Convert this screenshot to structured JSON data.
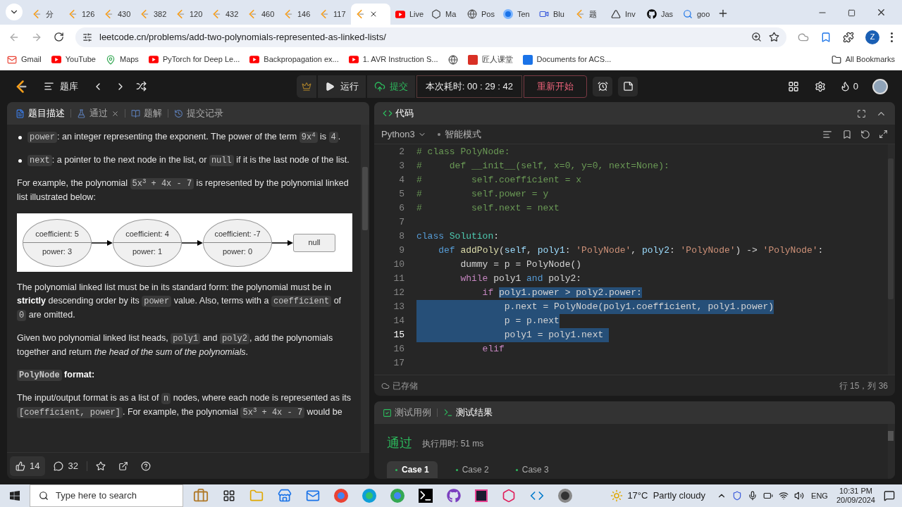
{
  "browser": {
    "tabs": [
      {
        "title": "分",
        "kind": "leetcode",
        "selected": false
      },
      {
        "title": "126",
        "kind": "leetcode",
        "selected": false
      },
      {
        "title": "430",
        "kind": "leetcode",
        "selected": false
      },
      {
        "title": "382",
        "kind": "leetcode",
        "selected": false
      },
      {
        "title": "120",
        "kind": "leetcode",
        "selected": false
      },
      {
        "title": "432",
        "kind": "leetcode",
        "selected": false
      },
      {
        "title": "460",
        "kind": "leetcode",
        "selected": false
      },
      {
        "title": "146",
        "kind": "leetcode",
        "selected": false
      },
      {
        "title": "117",
        "kind": "leetcode",
        "selected": false
      },
      {
        "kind": "leetcode",
        "selected": true
      },
      {
        "title": "Live",
        "kind": "youtube",
        "selected": false
      },
      {
        "title": "Ma",
        "kind": "openai",
        "selected": false
      },
      {
        "title": "Pos",
        "kind": "globe",
        "selected": false
      },
      {
        "title": "Ten",
        "kind": "circle",
        "selected": false
      },
      {
        "title": "Blu",
        "kind": "video",
        "selected": false
      },
      {
        "title": "题",
        "kind": "leetcode",
        "selected": false
      },
      {
        "title": "Inv",
        "kind": "triangle",
        "selected": false
      },
      {
        "title": "Jas",
        "kind": "github",
        "selected": false
      },
      {
        "title": "goo",
        "kind": "search",
        "selected": false
      }
    ],
    "url": "leetcode.cn/problems/add-two-polynomials-represented-as-linked-lists/",
    "profile": "Z",
    "bookmarks": [
      {
        "label": "Gmail",
        "kind": "gmail"
      },
      {
        "label": "YouTube",
        "kind": "youtube"
      },
      {
        "label": "Maps",
        "kind": "maps"
      },
      {
        "label": "PyTorch for Deep Le...",
        "kind": "youtube"
      },
      {
        "label": "Backpropagation ex...",
        "kind": "youtube"
      },
      {
        "label": "1. AVR Instruction S...",
        "kind": "youtube"
      },
      {
        "kind": "globe"
      },
      {
        "label": "匠人课堂",
        "kind": "red"
      },
      {
        "label": "Documents for ACS...",
        "kind": "number"
      }
    ],
    "all_bookmarks": "All Bookmarks"
  },
  "nav": {
    "problem_list": "题库",
    "run": "运行",
    "submit": "提交",
    "timer": "本次耗时: 00 : 29 : 42",
    "restart": "重新开始",
    "streak": "0"
  },
  "left_panel": {
    "tabs": [
      {
        "label": "题目描述",
        "kind": "description",
        "selected": true
      },
      {
        "label": "通过",
        "kind": "accepted",
        "selected": false
      },
      {
        "label": "题解",
        "kind": "solutions",
        "selected": false
      },
      {
        "label": "提交记录",
        "kind": "submissions",
        "selected": false
      }
    ],
    "blocks": [
      {
        "kind": "bullet",
        "segments": [
          {
            "kind": "code",
            "text": "power"
          },
          {
            "kind": "text",
            "text": ": an integer representing the exponent. The power of the term "
          },
          {
            "kind": "code",
            "text": "9x$^{4}$"
          },
          {
            "kind": "text",
            "text": " is "
          },
          {
            "kind": "code",
            "text": "4"
          },
          {
            "kind": "text",
            "text": "."
          }
        ]
      },
      {
        "kind": "bullet",
        "segments": [
          {
            "kind": "code",
            "text": "next"
          },
          {
            "kind": "text",
            "text": ": a pointer to the next node in the list, or "
          },
          {
            "kind": "code",
            "text": "null"
          },
          {
            "kind": "text",
            "text": " if it is the last node of the list."
          }
        ]
      },
      {
        "kind": "paragraph",
        "segments": [
          {
            "kind": "text",
            "text": "For example, the polynomial "
          },
          {
            "kind": "code",
            "text": "5x$^{3}$ + 4x - 7"
          },
          {
            "kind": "text",
            "text": " is represented by the polynomial linked list illustrated below:"
          }
        ]
      },
      {
        "kind": "diagram",
        "nodes": [
          {
            "coefficient": "coefficient: 5",
            "power": "power: 3"
          },
          {
            "coefficient": "coefficient: 4",
            "power": "power: 1"
          },
          {
            "coefficient": "coefficient: -7",
            "power": "power: 0"
          }
        ],
        "end": "null"
      },
      {
        "kind": "paragraph",
        "segments": [
          {
            "kind": "text",
            "text": "The polynomial linked list must be in its standard form: the polynomial must be in "
          },
          {
            "kind": "bold",
            "text": "strictly"
          },
          {
            "kind": "text",
            "text": " descending order by its "
          },
          {
            "kind": "code",
            "text": "power"
          },
          {
            "kind": "text",
            "text": " value. Also, terms with a "
          },
          {
            "kind": "code",
            "text": "coefficient"
          },
          {
            "kind": "text",
            "text": " of "
          },
          {
            "kind": "code",
            "text": "0"
          },
          {
            "kind": "text",
            "text": " are omitted."
          }
        ]
      },
      {
        "kind": "paragraph",
        "segments": [
          {
            "kind": "text",
            "text": "Given two polynomial linked list heads, "
          },
          {
            "kind": "code",
            "text": "poly1"
          },
          {
            "kind": "text",
            "text": " and "
          },
          {
            "kind": "code",
            "text": "poly2"
          },
          {
            "kind": "text",
            "text": ", add the polynomials together and return "
          },
          {
            "kind": "italic",
            "text": "the head of the sum of the polynomials"
          },
          {
            "kind": "text",
            "text": "."
          }
        ]
      },
      {
        "kind": "heading",
        "segments": [
          {
            "kind": "code",
            "text": "PolyNode"
          },
          {
            "kind": "bold",
            "text": " format:"
          }
        ]
      },
      {
        "kind": "paragraph",
        "segments": [
          {
            "kind": "text",
            "text": "The input/output format is as a list of "
          },
          {
            "kind": "code",
            "text": "n"
          },
          {
            "kind": "text",
            "text": " nodes, where each node is represented as its "
          },
          {
            "kind": "code",
            "text": "[coefficient, power]"
          },
          {
            "kind": "text",
            "text": ". For example, the polynomial "
          },
          {
            "kind": "code",
            "text": "5x$^{3}$ + 4x - 7"
          },
          {
            "kind": "text",
            "text": " would be"
          }
        ]
      }
    ],
    "likes": "14",
    "comments": "32"
  },
  "editor": {
    "title": "代码",
    "language": "Python3",
    "mode": "智能模式",
    "saved": "已存储",
    "position": "行 15，列 36",
    "lines": [
      {
        "number": "2",
        "current": false,
        "selected": false,
        "tokens": [
          {
            "kind": "comment",
            "text": "# class PolyNode:"
          }
        ]
      },
      {
        "number": "3",
        "current": false,
        "selected": false,
        "tokens": [
          {
            "kind": "comment",
            "text": "#     def __init__(self, x=0, y=0, next=None):"
          }
        ]
      },
      {
        "number": "4",
        "current": false,
        "selected": false,
        "tokens": [
          {
            "kind": "comment",
            "text": "#         self.coefficient = x"
          }
        ]
      },
      {
        "number": "5",
        "current": false,
        "selected": false,
        "tokens": [
          {
            "kind": "comment",
            "text": "#         self.power = y"
          }
        ]
      },
      {
        "number": "6",
        "current": false,
        "selected": false,
        "tokens": [
          {
            "kind": "comment",
            "text": "#         self.next = next"
          }
        ]
      },
      {
        "number": "7",
        "current": false,
        "selected": false
      },
      {
        "number": "8",
        "current": false,
        "selected": false,
        "tokens": [
          {
            "kind": "keyword",
            "text": "class "
          },
          {
            "kind": "type",
            "text": "Solution"
          },
          {
            "kind": "plain",
            "text": ":"
          }
        ]
      },
      {
        "number": "9",
        "current": false,
        "selected": false,
        "tokens": [
          {
            "kind": "keyword",
            "text": "    def "
          },
          {
            "kind": "function",
            "text": "addPoly"
          },
          {
            "kind": "plain",
            "text": "("
          },
          {
            "kind": "param",
            "text": "self"
          },
          {
            "kind": "plain",
            "text": ", "
          },
          {
            "kind": "param",
            "text": "poly1"
          },
          {
            "kind": "plain",
            "text": ": "
          },
          {
            "kind": "string",
            "text": "'PolyNode'"
          },
          {
            "kind": "plain",
            "text": ", "
          },
          {
            "kind": "param",
            "text": "poly2"
          },
          {
            "kind": "plain",
            "text": ": "
          },
          {
            "kind": "string",
            "text": "'PolyNode'"
          },
          {
            "kind": "plain",
            "text": ") -> "
          },
          {
            "kind": "string",
            "text": "'PolyNode'"
          },
          {
            "kind": "plain",
            "text": ":"
          }
        ]
      },
      {
        "number": "10",
        "current": false,
        "selected": false,
        "tokens": [
          {
            "kind": "plain",
            "text": "        dummy = p = PolyNode()"
          }
        ]
      },
      {
        "number": "11",
        "current": false,
        "selected": false,
        "tokens": [
          {
            "kind": "control",
            "text": "        while"
          },
          {
            "kind": "plain",
            "text": " poly1 "
          },
          {
            "kind": "keyword",
            "text": "and"
          },
          {
            "kind": "plain",
            "text": " poly2:"
          }
        ]
      },
      {
        "number": "12",
        "current": false,
        "selected": false,
        "tokens": [
          {
            "kind": "control",
            "text": "            if ",
            "highlighted": false
          },
          {
            "kind": "plain",
            "text": "poly1.power > poly2.power:",
            "highlighted": true
          }
        ]
      },
      {
        "number": "13",
        "current": false,
        "selected": true,
        "tokens": [
          {
            "kind": "plain",
            "text": "                p.next = PolyNode(poly1.coefficient, poly1.power)"
          }
        ]
      },
      {
        "number": "14",
        "current": false,
        "selected": true,
        "tokens": [
          {
            "kind": "plain",
            "text": "                p = p.next"
          }
        ]
      },
      {
        "number": "15",
        "current": true,
        "selected": true,
        "tokens": [
          {
            "kind": "plain",
            "text": "                poly1 = poly1.next "
          }
        ]
      },
      {
        "number": "16",
        "current": false,
        "selected": false,
        "tokens": [
          {
            "kind": "control",
            "text": "            elif"
          }
        ]
      },
      {
        "number": "17",
        "current": false,
        "selected": false
      }
    ]
  },
  "results": {
    "tabs": [
      {
        "label": "测试用例",
        "kind": "testcase",
        "selected": false
      },
      {
        "label": "测试结果",
        "kind": "result",
        "selected": true
      }
    ],
    "status": "通过",
    "runtime": "执行用时: 51 ms",
    "cases": [
      {
        "label": "Case 1",
        "selected": true
      },
      {
        "label": "Case 2",
        "selected": false
      },
      {
        "label": "Case 3",
        "selected": false
      }
    ]
  },
  "taskbar": {
    "search_placeholder": "Type here to search",
    "weather": "17°C  Partly cloudy",
    "language": "ENG",
    "time": "10:31 PM",
    "date": "20/09/2024"
  }
}
